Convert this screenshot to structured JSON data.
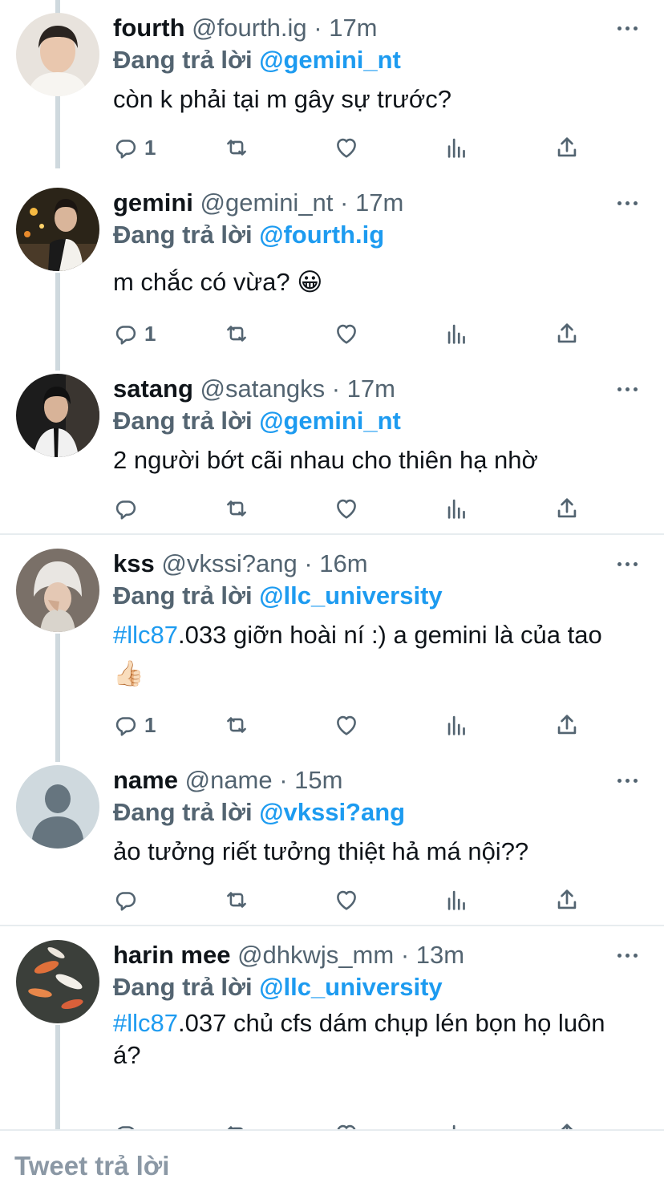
{
  "replying_prefix": "Đang trả lời",
  "compose": {
    "placeholder": "Tweet trả lời"
  },
  "colors": {
    "link": "#1d9bf0",
    "secondary": "#536471",
    "thread_line": "#cfd9de"
  },
  "icons": {
    "reply": "reply-icon",
    "retweet": "retweet-icon",
    "like": "heart-icon",
    "views": "analytics-icon",
    "share": "share-icon",
    "more": "more-icon"
  },
  "tweets": [
    {
      "name": "fourth",
      "handle": "@fourth.ig",
      "time": "· 17m",
      "reply_to": "@gemini_nt",
      "text": "còn k phải tại m gây sự trước?",
      "reply_count": "1"
    },
    {
      "name": "gemini",
      "handle": "@gemini_nt",
      "time": "· 17m",
      "reply_to": "@fourth.ig",
      "text": "m chắc có vừa?",
      "emoji": "😀",
      "reply_count": "1"
    },
    {
      "name": "satang",
      "handle": "@satangks",
      "time": "· 17m",
      "reply_to": "@gemini_nt",
      "text": "2 người bớt cãi nhau cho thiên hạ nhờ",
      "reply_count": ""
    },
    {
      "name": "kss",
      "handle": "@vkssi?ang",
      "time": "· 16m",
      "reply_to": "@llc_university",
      "hashtag": "#llc87",
      "text": ".033 giỡn hoài ní :) a gemini là của tao",
      "emoji": "👍🏻",
      "reply_count": "1"
    },
    {
      "name": "name",
      "handle": "@name",
      "time": "· 15m",
      "reply_to": "@vkssi?ang",
      "text": "ảo tưởng riết tưởng thiệt hả má nội??",
      "reply_count": ""
    },
    {
      "name": "harin mee",
      "handle": "@dhkwjs_mm",
      "time": "· 13m",
      "reply_to": "@llc_university",
      "hashtag": "#llc87",
      "text": ".037 chủ cfs dám chụp lén bọn họ luôn á?",
      "reply_count": ""
    }
  ]
}
